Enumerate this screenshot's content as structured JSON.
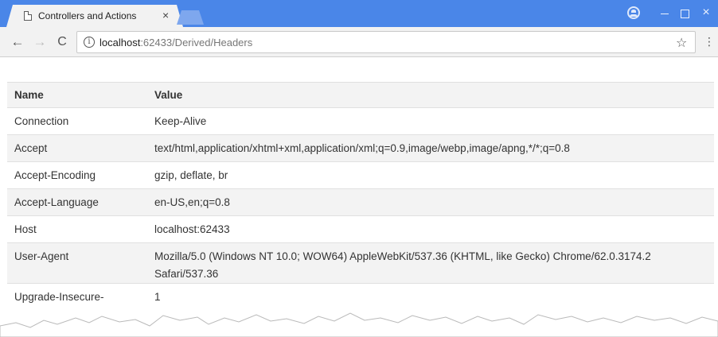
{
  "browser": {
    "tab_title": "Controllers and Actions",
    "tab_close": "×",
    "window_close": "×",
    "url_host": "localhost",
    "url_path": ":62433/Derived/Headers",
    "nav": {
      "back": "←",
      "forward": "→",
      "reload": "C"
    },
    "bookmark_star": "☆",
    "menu": "⋮",
    "info": "i",
    "accent_color": "#4a86e8"
  },
  "table": {
    "columns": [
      "Name",
      "Value"
    ],
    "rows": [
      {
        "name": "Connection",
        "value": "Keep-Alive"
      },
      {
        "name": "Accept",
        "value": "text/html,application/xhtml+xml,application/xml;q=0.9,image/webp,image/apng,*/*;q=0.8"
      },
      {
        "name": "Accept-Encoding",
        "value": "gzip, deflate, br"
      },
      {
        "name": "Accept-Language",
        "value": "en-US,en;q=0.8"
      },
      {
        "name": "Host",
        "value": "localhost:62433"
      },
      {
        "name": "User-Agent",
        "value": "Mozilla/5.0 (Windows NT 10.0; WOW64) AppleWebKit/537.36 (KHTML, like Gecko) Chrome/62.0.3174.2 Safari/537.36"
      },
      {
        "name": "Upgrade-Insecure-",
        "value": "1"
      }
    ]
  }
}
